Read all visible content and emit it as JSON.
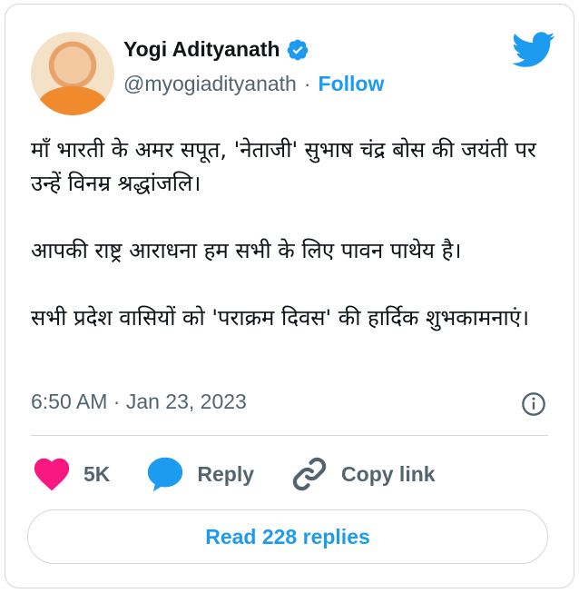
{
  "author": {
    "name": "Yogi Adityanath",
    "handle": "@myogiadityanath",
    "separator": "·",
    "follow_label": "Follow"
  },
  "tweet": {
    "paragraphs": [
      "माँ भारती के अमर सपूत, 'नेताजी' सुभाष चंद्र बोस की जयंती पर उन्हें विनम्र श्रद्धांजलि।",
      "आपकी राष्ट्र आराधना हम सभी के लिए पावन पाथेय है।",
      "सभी प्रदेश वासियों को 'पराक्रम दिवस' की हार्दिक शुभकामनाएं।"
    ],
    "timestamp": "6:50 AM · Jan 23, 2023"
  },
  "actions": {
    "like_count": "5K",
    "reply_label": "Reply",
    "copy_label": "Copy link"
  },
  "read_replies_label": "Read 228 replies",
  "icons": {
    "brand": "twitter-bird-icon",
    "verified": "verified-badge-icon",
    "like": "heart-icon",
    "reply": "speech-bubble-icon",
    "copy": "link-icon",
    "info": "info-icon"
  },
  "colors": {
    "accent": "#1d9bf0",
    "like": "#f91880",
    "muted": "#536471",
    "border": "#cfd9de"
  }
}
